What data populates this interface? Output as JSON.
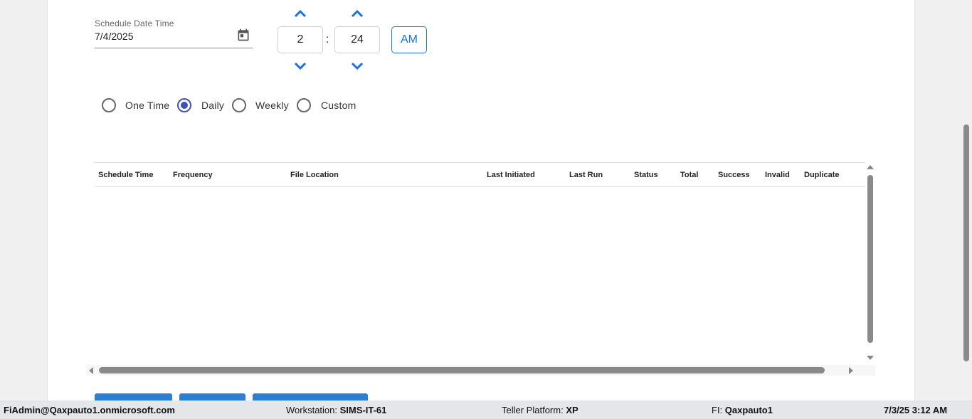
{
  "schedule": {
    "label": "Schedule Date Time",
    "date_value": "7/4/2025",
    "calendar_icon": "calendar-icon"
  },
  "time": {
    "hour": "2",
    "separator": ":",
    "minute": "24",
    "period": "AM",
    "accent_color": "#1a73e8"
  },
  "frequency": {
    "selected": "Daily",
    "options": [
      "One Time",
      "Daily",
      "Weekly",
      "Custom"
    ]
  },
  "table": {
    "columns": [
      "Schedule Time",
      "Frequency",
      "File Location",
      "Last Initiated",
      "Last Run",
      "Status",
      "Total",
      "Success",
      "Invalid",
      "Duplicate"
    ],
    "rows": []
  },
  "statusbar": {
    "user": "FiAdmin@Qaxpauto1.onmicrosoft.com",
    "workstation_label": "Workstation:",
    "workstation_value": "SIMS-IT-61",
    "platform_label": "Teller Platform:",
    "platform_value": "XP",
    "fi_label": "FI:",
    "fi_value": "Qaxpauto1",
    "datetime": "7/3/25 3:12 AM"
  },
  "colors": {
    "primary_button": "#2f7fd1",
    "radio_selected": "#3f51b5"
  }
}
